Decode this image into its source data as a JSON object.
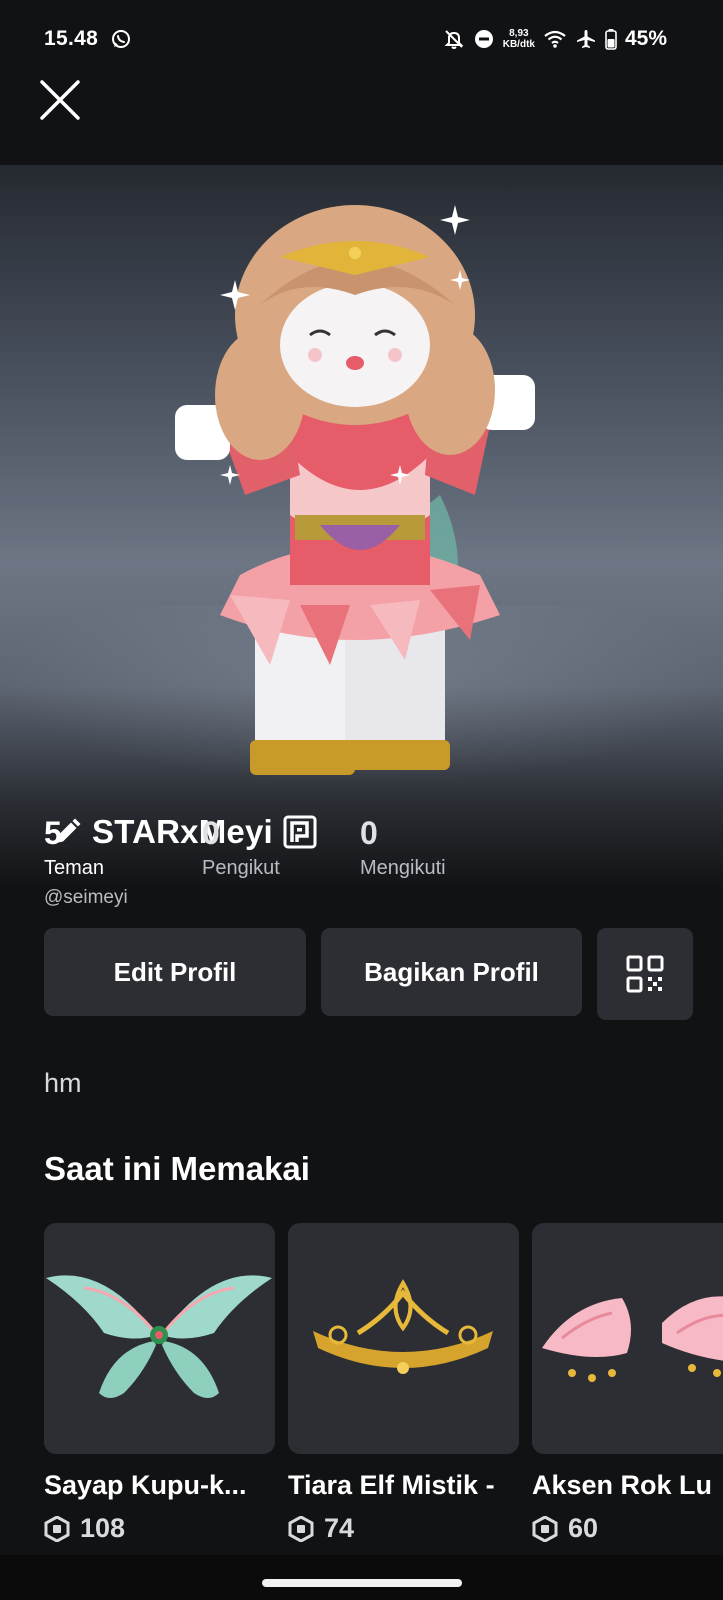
{
  "status_bar": {
    "time": "15.48",
    "speed_value": "8,93",
    "speed_unit": "KB/dtk",
    "battery": "45%",
    "icons": [
      "whatsapp-icon",
      "bell-off-icon",
      "do-not-disturb-icon",
      "wifi-icon",
      "airplane-icon",
      "battery-icon"
    ]
  },
  "profile": {
    "display_name": "STARxMeyi",
    "username": "@seimeyi",
    "bio": "hm"
  },
  "stats": [
    {
      "value": "5",
      "label": "Teman"
    },
    {
      "value": "0",
      "label": "Pengikut"
    },
    {
      "value": "0",
      "label": "Mengikuti"
    }
  ],
  "actions": {
    "edit_label": "Edit Profil",
    "share_label": "Bagikan Profil"
  },
  "wearing": {
    "title": "Saat ini Memakai",
    "items": [
      {
        "name": "Sayap Kupu-k...",
        "price": "108"
      },
      {
        "name": "Tiara Elf Mistik -",
        "price": "74"
      },
      {
        "name": "Aksen Rok Lu",
        "price": "60"
      }
    ]
  },
  "colors": {
    "background": "#111214",
    "button": "#2c2e33",
    "text": "#ffffff",
    "muted": "#b9bcc2"
  }
}
